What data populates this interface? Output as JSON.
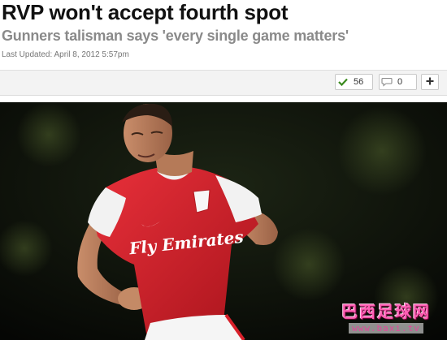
{
  "article": {
    "headline": "RVP won't accept fourth spot",
    "subheadline": "Gunners talisman says 'every single game matters'",
    "last_updated": "Last Updated: April 8, 2012 5:57pm"
  },
  "toolbar": {
    "likes_count": "56",
    "comments_count": "0",
    "likes_icon": "checkmark-icon",
    "comments_icon": "speech-bubble-icon",
    "add_icon": "plus-icon"
  },
  "photo": {
    "shirt_sponsor": "Fly Emirates"
  },
  "watermark": {
    "title": "巴西足球网",
    "url": "www.baxi.tv"
  },
  "colors": {
    "headline": "#111111",
    "subheadline": "#8a8a8a",
    "check_green": "#3a8a1e",
    "shirt_red": "#d8202a",
    "watermark_pink": "#ff5fb4"
  }
}
